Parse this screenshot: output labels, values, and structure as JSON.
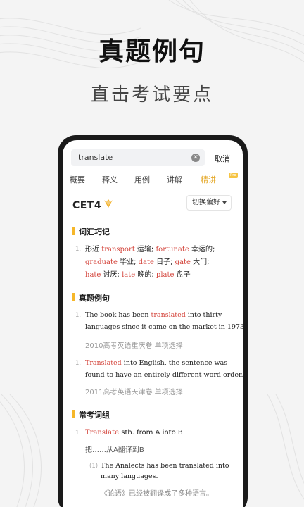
{
  "promo": {
    "title": "真题例句",
    "subtitle": "直击考试要点"
  },
  "search": {
    "query": "translate",
    "clear_icon": "clear-circle-icon",
    "cancel_label": "取消"
  },
  "tabs": [
    {
      "label": "概要",
      "active": false
    },
    {
      "label": "释义",
      "active": false
    },
    {
      "label": "用例",
      "active": false
    },
    {
      "label": "讲解",
      "active": false
    },
    {
      "label": "精讲",
      "active": true,
      "badge": "Pro"
    }
  ],
  "level": {
    "label": "CET4",
    "icon": "crown-badge-icon",
    "preference_label": "切换偏好"
  },
  "sections": {
    "memory": {
      "title": "词汇巧记",
      "number": "1.",
      "lines": [
        [
          {
            "t": "形近 ",
            "r": false
          },
          {
            "t": "transport",
            "r": true
          },
          {
            "t": " 运输;  ",
            "r": false
          },
          {
            "t": "fortunate",
            "r": true
          },
          {
            "t": " 幸运的;",
            "r": false
          }
        ],
        [
          {
            "t": "graduate",
            "r": true
          },
          {
            "t": " 毕业;  ",
            "r": false
          },
          {
            "t": "date",
            "r": true
          },
          {
            "t": " 日子;  ",
            "r": false
          },
          {
            "t": "gate",
            "r": true
          },
          {
            "t": " 大门;",
            "r": false
          }
        ],
        [
          {
            "t": "hate",
            "r": true
          },
          {
            "t": " 讨厌;  ",
            "r": false
          },
          {
            "t": "late",
            "r": true
          },
          {
            "t": " 晚的;  ",
            "r": false
          },
          {
            "t": "plate",
            "r": true
          },
          {
            "t": " 盘子",
            "r": false
          }
        ]
      ]
    },
    "examples": {
      "title": "真题例句",
      "items": [
        {
          "number": "1.",
          "lines": [
            [
              {
                "t": "The book has been ",
                "r": false
              },
              {
                "t": "translated",
                "r": true
              },
              {
                "t": "  into thirty",
                "r": false
              }
            ],
            [
              {
                "t": "languages since it came on the market in 1973.",
                "r": false
              }
            ]
          ],
          "source": "2010高考英语重庆卷  单项选择"
        },
        {
          "number": "1.",
          "lines": [
            [
              {
                "t": "Translated",
                "r": true
              },
              {
                "t": " into English, the sentence was",
                "r": false
              }
            ],
            [
              {
                "t": "found to have an entirely different word order.",
                "r": false
              }
            ]
          ],
          "source": "2011高考英语天津卷  单项选择"
        }
      ]
    },
    "phrases": {
      "title": "常考词组",
      "number": "1.",
      "phrase_word": "Translate",
      "phrase_rest": " sth. from A into B",
      "meaning": "把……从A翻译到B",
      "sub_number": "(1)",
      "sub_en": [
        "The Analects has been translated into",
        "many languages."
      ],
      "sub_cn": "《论语》已经被翻译成了多种语言。"
    }
  }
}
